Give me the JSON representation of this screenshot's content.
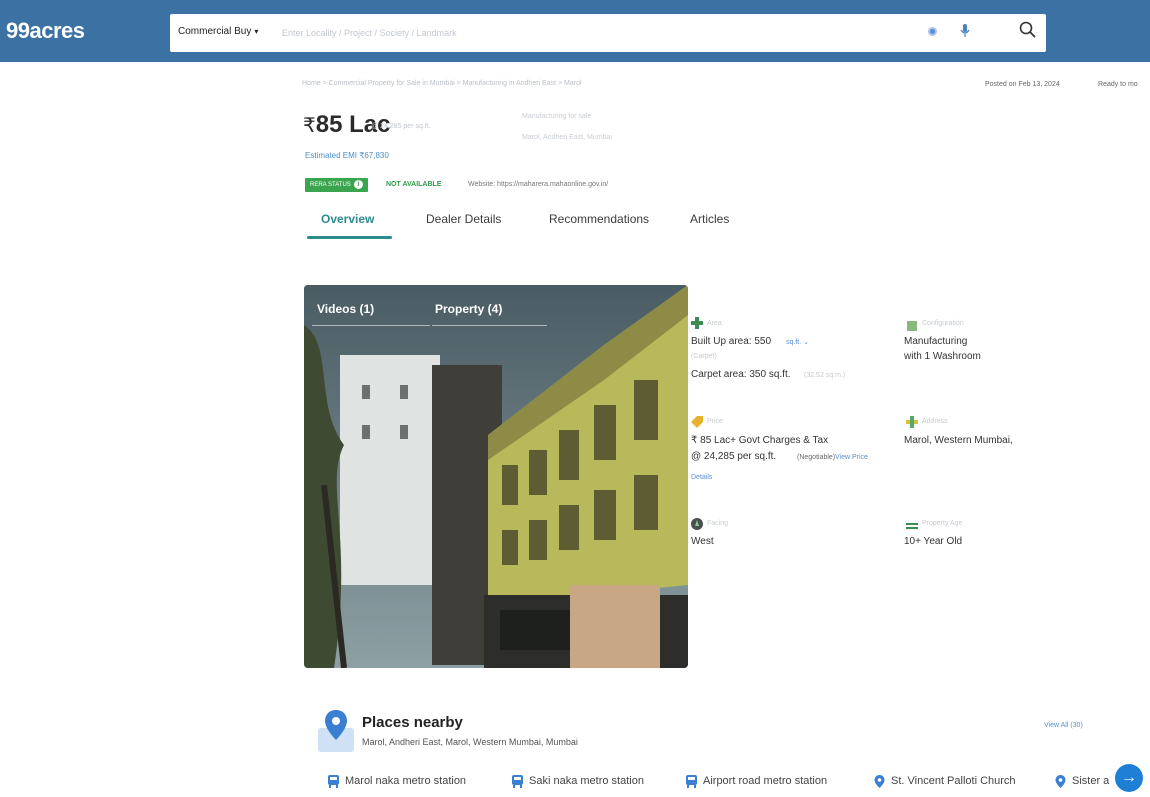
{
  "header": {
    "logo": "99acres",
    "search_type": "Commercial Buy",
    "search_placeholder": "Enter Locality / Project / Society / Landmark"
  },
  "subheader": {
    "breadcrumb": "Home > Commercial Property for Sale in Mumbai > Manufacturing in Andheri East > Marol",
    "posted": "Posted on Feb 13, 2024",
    "ready": "Ready to mo"
  },
  "price": {
    "symbol": "₹",
    "amount": "85 Lac",
    "per_sqft": "@ 24,285 per sq.ft.",
    "emi": "Estimated EMI ₹67,830",
    "project_title": "Manufacturing for sale",
    "project_location": "Marol, Andheri East, Mumbai"
  },
  "rera": {
    "badge": "RERA STATUS",
    "status": "NOT AVAILABLE",
    "website": "Website: https://maharera.mahaonline.gov.in/"
  },
  "tabs": [
    "Overview",
    "Dealer Details",
    "Recommendations",
    "Articles"
  ],
  "media": {
    "tab_videos": "Videos (1)",
    "tab_property": "Property (4)"
  },
  "details": {
    "area_label": "Area",
    "built_up": "Built Up area: 550",
    "unit": "sq.ft. ⌄",
    "carpet_label": "(Carpet)",
    "carpet": "Carpet area: 350 sq.ft.",
    "carpet_extra": "(32.52 sq.m.)",
    "config_label": "Configuration",
    "config_1": "Manufacturing",
    "config_2": "with 1 Washroom",
    "price_label": "Price",
    "price_line": "₹ 85 Lac+ Govt Charges & Tax",
    "price_sqft": "@ 24,285 per sq.ft.",
    "negotiable": "(Negotiable)",
    "view_price": "View Price",
    "details_link": "Details",
    "address_label": "Address",
    "address": "Marol, Western Mumbai,",
    "facing_label": "Facing",
    "facing": "West",
    "age_label": "Property Age",
    "age": "10+ Year Old"
  },
  "places": {
    "title": "Places nearby",
    "subtitle": "Marol, Andheri East, Marol, Western Mumbai, Mumbai",
    "view_all": "View All (30)",
    "chips": [
      "Marol naka metro station",
      "Saki naka metro station",
      "Airport road metro station",
      "St. Vincent Palloti Church",
      "Sister a"
    ]
  },
  "colors": {
    "header": "#3c71a4",
    "accent": "#2d8c8f",
    "rera_green": "#3aa54e",
    "link": "#5b8fd0",
    "fab": "#1f7fd6"
  }
}
